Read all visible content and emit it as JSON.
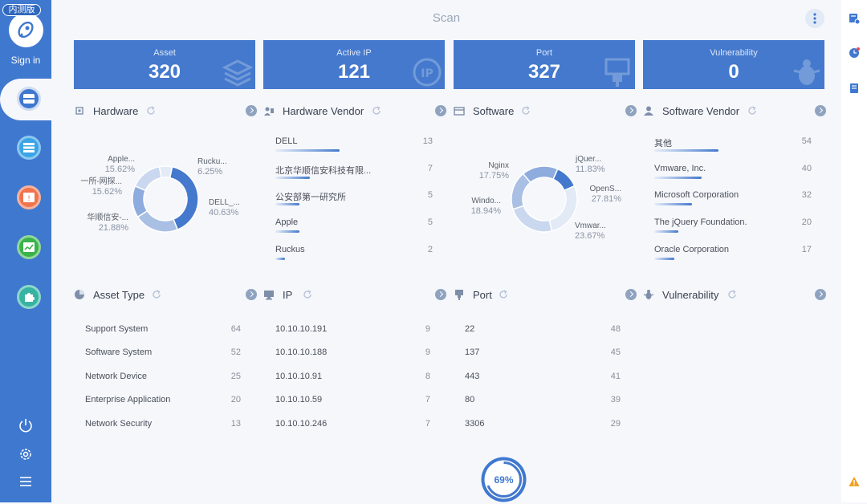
{
  "app": {
    "title": "Scan",
    "beta_badge": "内测版",
    "sign_in": "Sign in"
  },
  "colors": {
    "primary": "#4479cd",
    "sidebar": "#3f78cf",
    "nav_blue": "#3aa4e6",
    "nav_orange": "#f0744e",
    "nav_green": "#3bb34a",
    "nav_teal": "#37b3a2",
    "warning": "#f0a020"
  },
  "stats": [
    {
      "label": "Asset",
      "value": "320",
      "icon": "stack-icon"
    },
    {
      "label": "Active IP",
      "value": "121",
      "icon": "ip-icon"
    },
    {
      "label": "Port",
      "value": "327",
      "icon": "port-icon"
    },
    {
      "label": "Vulnerability",
      "value": "0",
      "icon": "bug-icon"
    }
  ],
  "panels": {
    "hardware": {
      "title": "Hardware",
      "slices": [
        {
          "name": "DELL_...",
          "pct": "40.63%",
          "value": 40.63
        },
        {
          "name": "华顺信安-...",
          "pct": "21.88%",
          "value": 21.88
        },
        {
          "name": "一所-网探...",
          "pct": "15.62%",
          "value": 15.62
        },
        {
          "name": "Apple...",
          "pct": "15.62%",
          "value": 15.62
        },
        {
          "name": "Rucku...",
          "pct": "6.25%",
          "value": 6.25
        }
      ]
    },
    "hardware_vendor": {
      "title": "Hardware Vendor",
      "rows": [
        {
          "name": "DELL",
          "count": "13",
          "fraction": 1.0
        },
        {
          "name": "北京华顺信安科技有限...",
          "count": "7",
          "fraction": 0.54
        },
        {
          "name": "公安部第一研究所",
          "count": "5",
          "fraction": 0.38
        },
        {
          "name": "Apple",
          "count": "5",
          "fraction": 0.38
        },
        {
          "name": "Ruckus",
          "count": "2",
          "fraction": 0.15
        }
      ]
    },
    "software": {
      "title": "Software",
      "slices": [
        {
          "name": "jQuer...",
          "pct": "11.83%",
          "value": 11.83
        },
        {
          "name": "OpenS...",
          "pct": "27.81%",
          "value": 27.81
        },
        {
          "name": "Vmwar...",
          "pct": "23.67%",
          "value": 23.67
        },
        {
          "name": "Windo...",
          "pct": "18.94%",
          "value": 18.94
        },
        {
          "name": "Nginx",
          "pct": "17.75%",
          "value": 17.75
        }
      ]
    },
    "software_vendor": {
      "title": "Software Vendor",
      "rows": [
        {
          "name": "其他",
          "count": "54",
          "fraction": 1.0
        },
        {
          "name": "Vmware, Inc.",
          "count": "40",
          "fraction": 0.74
        },
        {
          "name": "Microsoft Corporation",
          "count": "32",
          "fraction": 0.59
        },
        {
          "name": "The jQuery Foundation.",
          "count": "20",
          "fraction": 0.37
        },
        {
          "name": "Oracle Corporation",
          "count": "17",
          "fraction": 0.31
        }
      ]
    },
    "asset_type": {
      "title": "Asset Type",
      "rows": [
        {
          "name": "Support System",
          "count": "64"
        },
        {
          "name": "Software System",
          "count": "52"
        },
        {
          "name": "Network Device",
          "count": "25"
        },
        {
          "name": "Enterprise Application",
          "count": "20"
        },
        {
          "name": "Network Security",
          "count": "13"
        }
      ]
    },
    "ip": {
      "title": "IP",
      "rows": [
        {
          "name": "10.10.10.191",
          "count": "9"
        },
        {
          "name": "10.10.10.188",
          "count": "9"
        },
        {
          "name": "10.10.10.91",
          "count": "8"
        },
        {
          "name": "10.10.10.59",
          "count": "7"
        },
        {
          "name": "10.10.10.246",
          "count": "7"
        }
      ]
    },
    "port": {
      "title": "Port",
      "rows": [
        {
          "name": "22",
          "count": "48"
        },
        {
          "name": "137",
          "count": "45"
        },
        {
          "name": "443",
          "count": "41"
        },
        {
          "name": "80",
          "count": "39"
        },
        {
          "name": "3306",
          "count": "29"
        }
      ]
    },
    "vulnerability": {
      "title": "Vulnerability"
    }
  },
  "progress": {
    "label": "69%",
    "value": 0.69
  }
}
